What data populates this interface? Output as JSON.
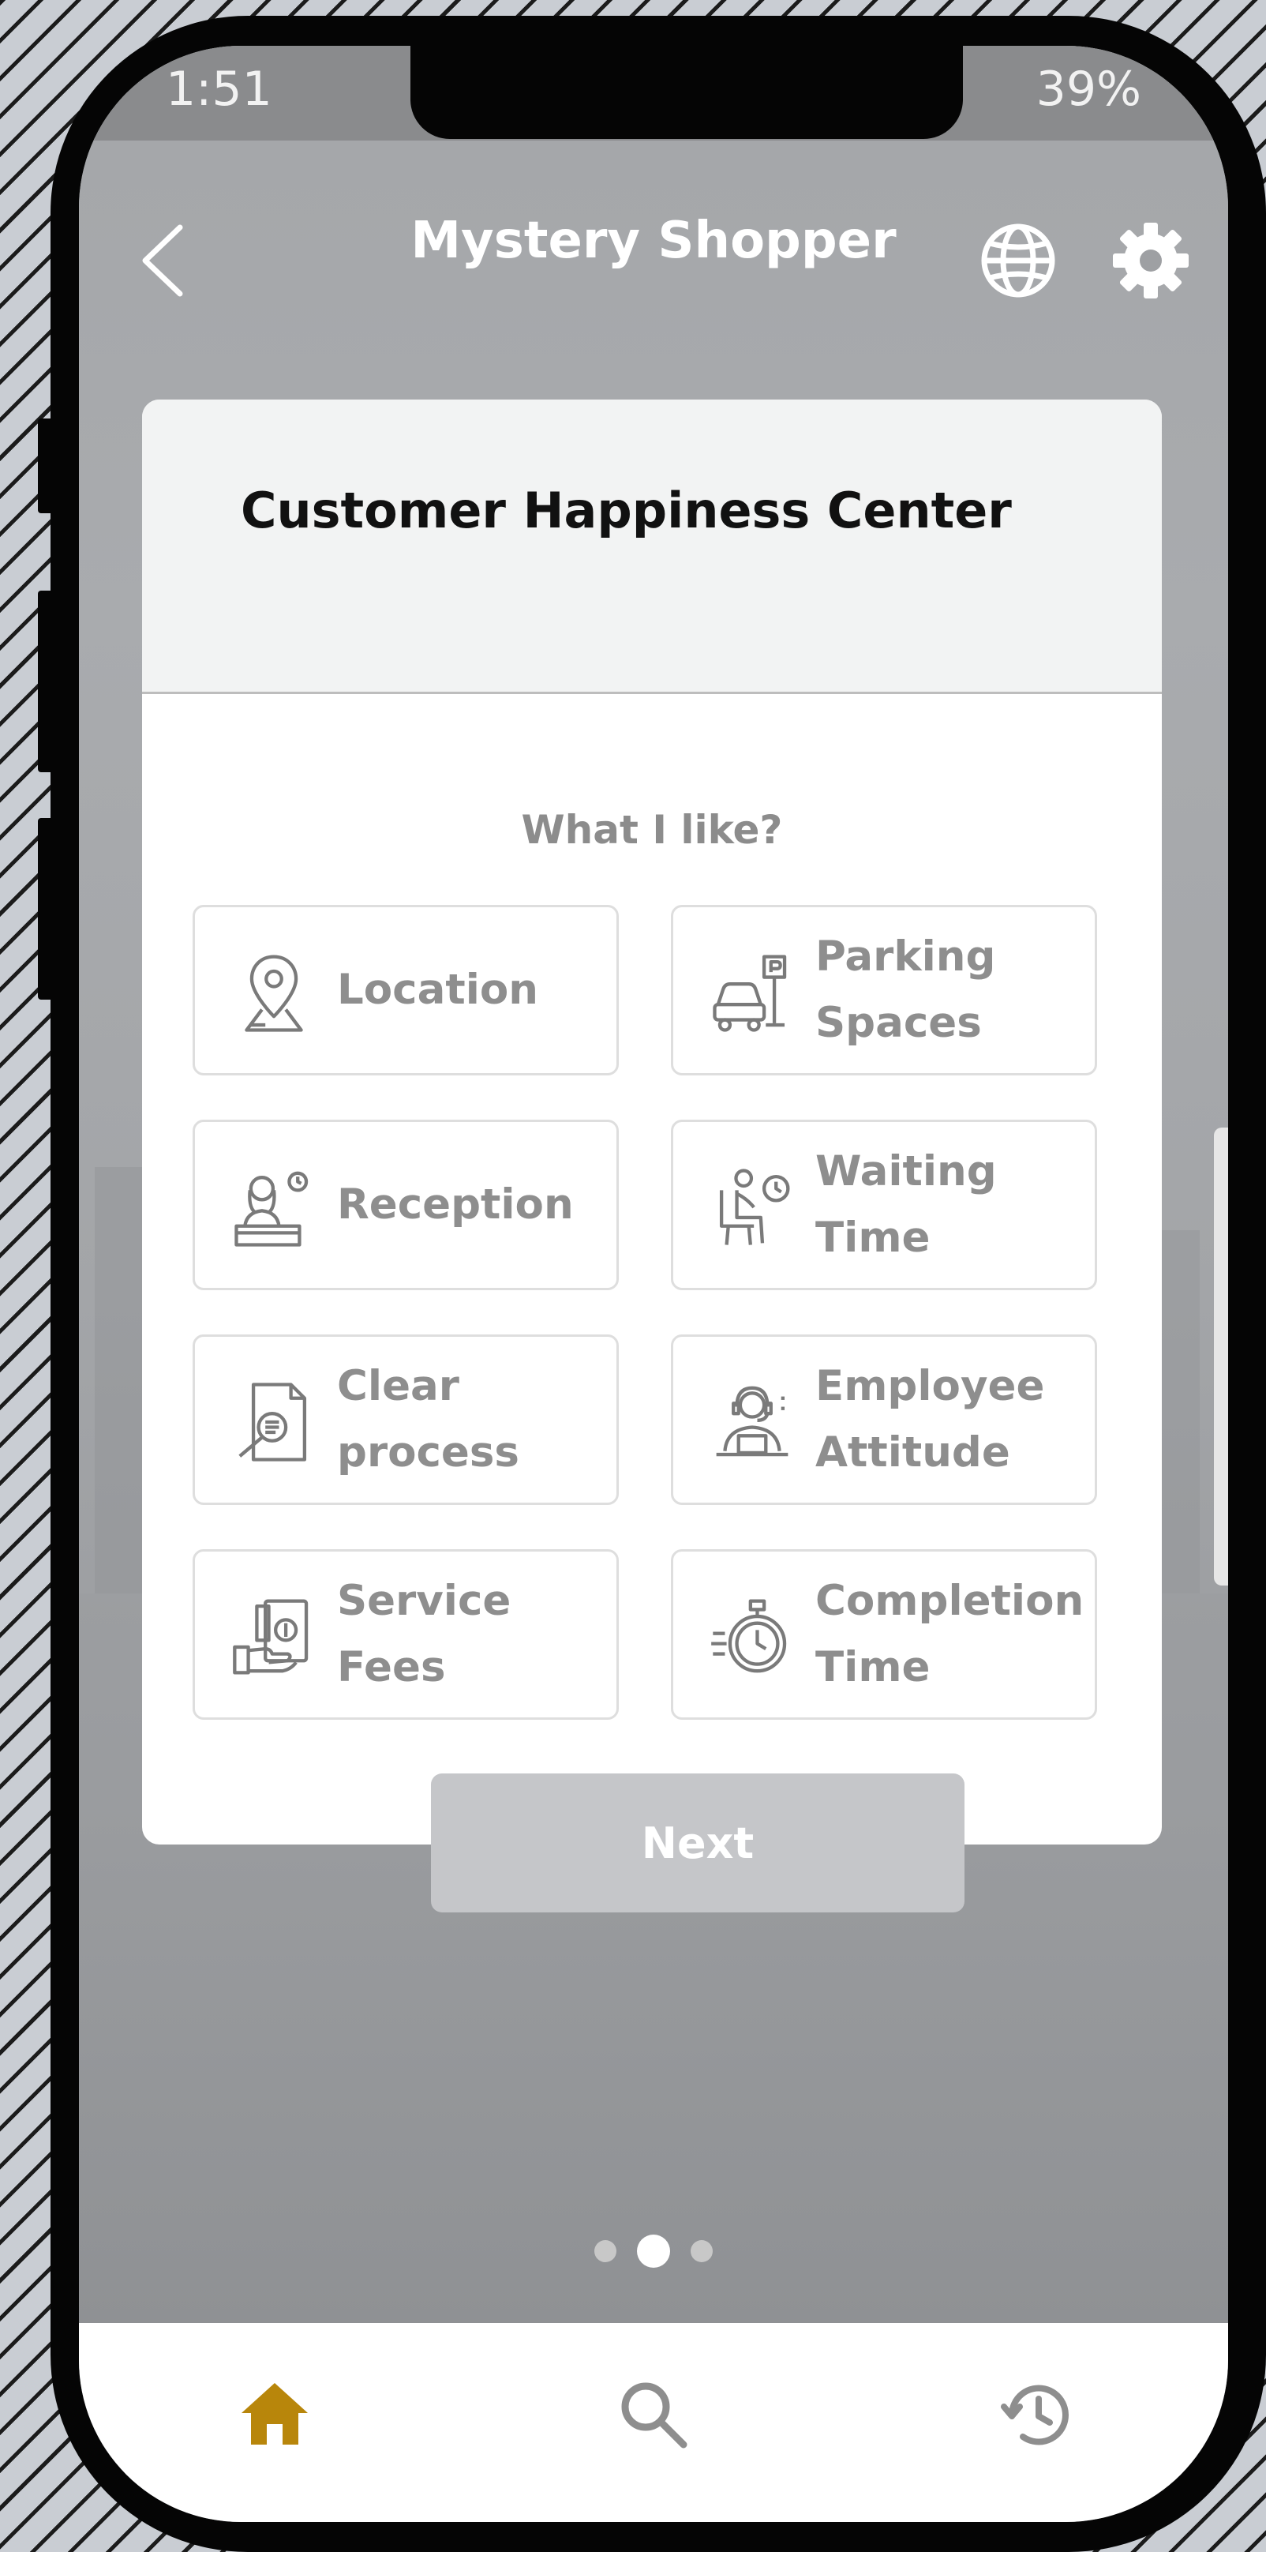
{
  "status_bar": {
    "time": "1:51",
    "indicators": "39%"
  },
  "header": {
    "title": "Mystery Shopper",
    "back_icon": "chevron-left-icon",
    "language_icon": "globe-icon",
    "settings_icon": "gear-icon"
  },
  "card": {
    "title": "Customer Happiness Center",
    "question": "What I like?",
    "options": [
      {
        "label": "Location",
        "icon": "map-pin-icon"
      },
      {
        "label": "Parking Spaces",
        "icon": "parking-car-icon"
      },
      {
        "label": "Reception",
        "icon": "receptionist-icon"
      },
      {
        "label": "Waiting Time",
        "icon": "waiting-person-clock-icon"
      },
      {
        "label": "Clear process",
        "icon": "document-search-icon"
      },
      {
        "label": "Employee Attitude",
        "icon": "employee-headset-icon"
      },
      {
        "label": "Service Fees",
        "icon": "hand-money-icon"
      },
      {
        "label": "Completion Time",
        "icon": "stopwatch-icon"
      }
    ]
  },
  "next_button": {
    "label": "Next"
  },
  "pagination": {
    "total": 3,
    "active": 2
  },
  "bottom_nav": [
    {
      "name": "home",
      "icon": "home-icon",
      "active": true
    },
    {
      "name": "search",
      "icon": "search-icon",
      "active": false
    },
    {
      "name": "history",
      "icon": "history-icon",
      "active": false
    }
  ],
  "colors": {
    "accent": "#b8860b",
    "option_text": "#8e8e8e",
    "card_title": "#111111",
    "next_button_bg": "#c5c6c9"
  }
}
